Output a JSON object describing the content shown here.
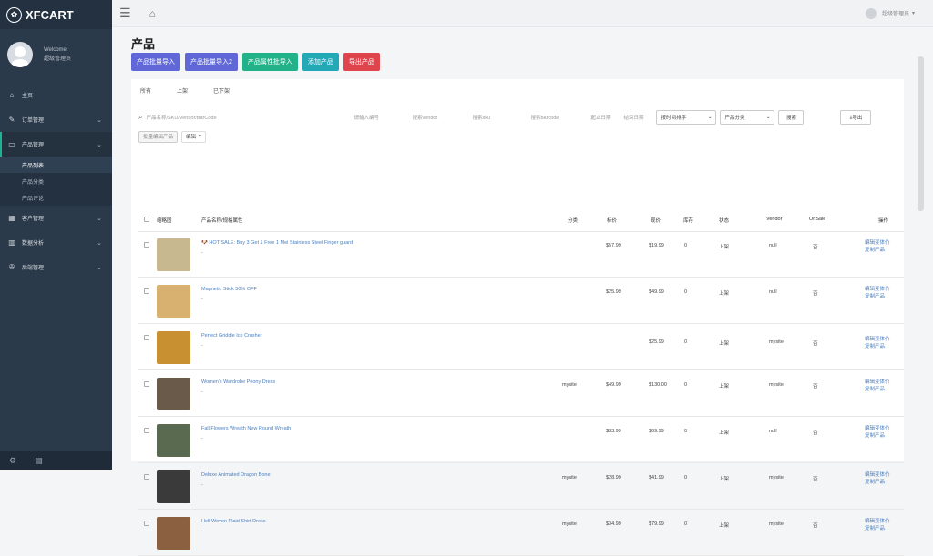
{
  "app": {
    "name": "XFCART"
  },
  "user": {
    "welcome": "Welcome,",
    "name": "超级管理员"
  },
  "nav": [
    {
      "label": "主页",
      "icon": "home-icon"
    },
    {
      "label": "订单管理",
      "icon": "edit-icon"
    },
    {
      "label": "产品管理",
      "icon": "desktop-icon",
      "sub": [
        "产品列表",
        "产品分类",
        "产品评论"
      ]
    },
    {
      "label": "客户管理",
      "icon": "table-icon"
    },
    {
      "label": "数据分析",
      "icon": "chart-icon"
    },
    {
      "label": "后端管理",
      "icon": "wrench-icon"
    }
  ],
  "topbar": {
    "user": "超级管理员"
  },
  "page": {
    "title": "产品"
  },
  "buttons": {
    "import1": "产品批量导入",
    "import2": "产品批量导入2",
    "variant_import": "产品属性批导入",
    "add": "添加产品",
    "export": "导出产品"
  },
  "tabs": [
    "所有",
    "上架",
    "已下架"
  ],
  "filter": {
    "search_placeholder": "产品名称/SKU/Vendor/BarCode",
    "f2": "请输入编号",
    "f3": "搜索vendor",
    "f4": "搜索sku",
    "f5": "搜索barcode",
    "date_start": "起止日期",
    "date_end": "结束日期",
    "sort": "按时间排序",
    "category": "产品分类",
    "search_btn": "搜索",
    "export_btn": "导出"
  },
  "bulk": {
    "edit_btn": "批量编辑产品",
    "action": "编辑"
  },
  "columns": [
    "缩略图",
    "产品名称/规格属性",
    "分类",
    "标价",
    "现价",
    "库存",
    "状态",
    "Vendor",
    "OnSale",
    "操作"
  ],
  "rows": [
    {
      "name": "🐶 HOT SALE: Buy 3 Get 1 Free 1 Mei Stainless Steel Finger guard",
      "category": "",
      "compare": "$57.99",
      "price": "$19.99",
      "stock": "0",
      "status": "上架",
      "vendor": "null",
      "onsale": "否",
      "actions": [
        "编辑变体价",
        "复制产品"
      ]
    },
    {
      "name": "Magnetic Stick 50% OFF",
      "category": "",
      "compare": "$25.99",
      "price": "$49.99",
      "stock": "0",
      "status": "上架",
      "vendor": "null",
      "onsale": "否",
      "actions": [
        "编辑变体价",
        "复制产品"
      ]
    },
    {
      "name": "Perfect Griddle Ice Crusher",
      "category": "",
      "compare": "",
      "price": "$25.99",
      "stock": "0",
      "status": "上架",
      "vendor": "mysite",
      "onsale": "否",
      "actions": [
        "编辑变体价",
        "复制产品"
      ]
    },
    {
      "name": "Women's Wardrobe Peony Dress",
      "category": "mysite",
      "compare": "$49.99",
      "price": "$130.00",
      "stock": "0",
      "status": "上架",
      "vendor": "mysite",
      "onsale": "否",
      "actions": [
        "编辑变体价",
        "复制产品"
      ]
    },
    {
      "name": "Fall Flowers Wreath New Round Wreath",
      "category": "",
      "compare": "$33.99",
      "price": "$69.99",
      "stock": "0",
      "status": "上架",
      "vendor": "null",
      "onsale": "否",
      "actions": [
        "编辑变体价",
        "复制产品"
      ]
    },
    {
      "name": "Deluxe Animated Dragon Bone",
      "category": "mysite",
      "compare": "$28.99",
      "price": "$41.99",
      "stock": "0",
      "status": "上架",
      "vendor": "mysite",
      "onsale": "否",
      "actions": [
        "编辑变体价",
        "复制产品"
      ]
    },
    {
      "name": "Hell Woven Plaid Shirt Dress",
      "category": "mysite",
      "compare": "$34.99",
      "price": "$79.99",
      "stock": "0",
      "status": "上架",
      "vendor": "mysite",
      "onsale": "否",
      "actions": [
        "编辑变体价",
        "复制产品"
      ]
    }
  ],
  "thumb_colors": [
    "#c8b890",
    "#d8b070",
    "#c89030",
    "#6a5a4a",
    "#5a6a50",
    "#3a3a3a",
    "#8a6040"
  ]
}
